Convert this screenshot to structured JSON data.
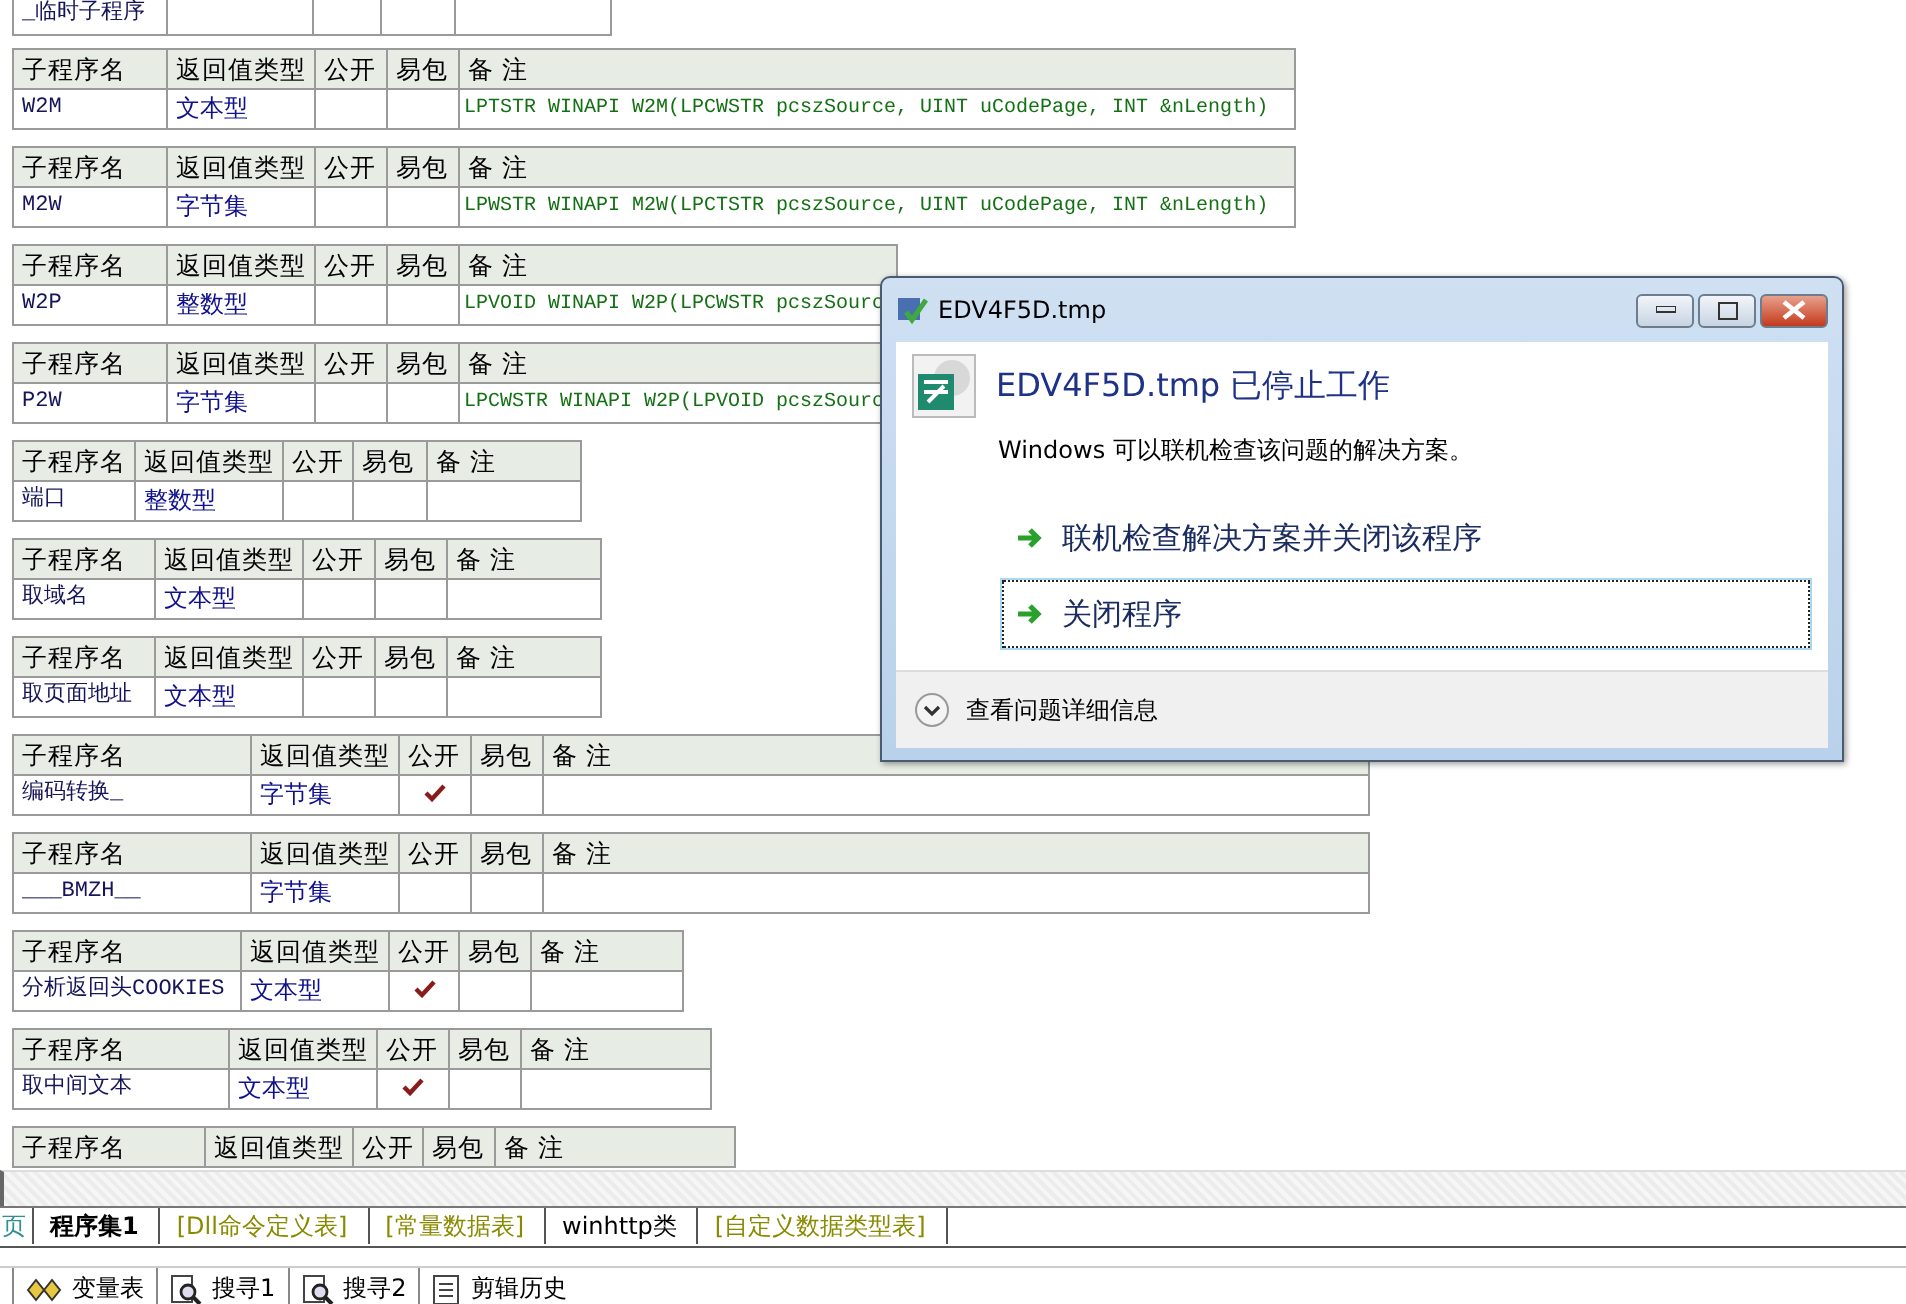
{
  "procedures": [
    {
      "name": "_临时子程序",
      "public": false
    },
    {
      "headers": [
        "子程序名",
        "返回值类型",
        "公开",
        "易包",
        "备 注"
      ],
      "name": "W2M",
      "return_type": "文本型",
      "public": false,
      "remark": "LPTSTR WINAPI W2M(LPCWSTR pcszSource, UINT uCodePage, INT &nLength)"
    },
    {
      "headers": [
        "子程序名",
        "返回值类型",
        "公开",
        "易包",
        "备 注"
      ],
      "name": "M2W",
      "return_type": "字节集",
      "public": false,
      "remark": "LPWSTR WINAPI M2W(LPCTSTR pcszSource, UINT uCodePage, INT &nLength)"
    },
    {
      "headers": [
        "子程序名",
        "返回值类型",
        "公开",
        "易包",
        "备 注"
      ],
      "name": "W2P",
      "return_type": "整数型",
      "public": false,
      "remark": "LPVOID WINAPI W2P(LPCWSTR pcszSourc"
    },
    {
      "headers": [
        "子程序名",
        "返回值类型",
        "公开",
        "易包",
        "备 注"
      ],
      "name": "P2W",
      "return_type": "字节集",
      "public": false,
      "remark": "LPCWSTR WINAPI W2P(LPVOID pcszSourc"
    },
    {
      "headers": [
        "子程序名",
        "返回值类型",
        "公开",
        "易包",
        "备 注"
      ],
      "name": "端口",
      "return_type": "整数型",
      "public": false
    },
    {
      "headers": [
        "子程序名",
        "返回值类型",
        "公开",
        "易包",
        "备 注"
      ],
      "name": "取域名",
      "return_type": "文本型",
      "public": false
    },
    {
      "headers": [
        "子程序名",
        "返回值类型",
        "公开",
        "易包",
        "备 注"
      ],
      "name": "取页面地址",
      "return_type": "文本型",
      "public": false
    },
    {
      "headers": [
        "子程序名",
        "返回值类型",
        "公开",
        "易包",
        "备 注"
      ],
      "name": "编码转换_",
      "return_type": "字节集",
      "public": true
    },
    {
      "headers": [
        "子程序名",
        "返回值类型",
        "公开",
        "易包",
        "备 注"
      ],
      "name": "___BMZH__",
      "return_type": "字节集",
      "public": false
    },
    {
      "headers": [
        "子程序名",
        "返回值类型",
        "公开",
        "易包",
        "备 注"
      ],
      "name": "分析返回头COOKIES",
      "return_type": "文本型",
      "public": true
    },
    {
      "headers": [
        "子程序名",
        "返回值类型",
        "公开",
        "易包",
        "备 注"
      ],
      "name": "取中间文本",
      "return_type": "文本型",
      "public": true
    },
    {
      "headers": [
        "子程序名",
        "返回值类型",
        "公开",
        "易包",
        "备 注"
      ]
    }
  ],
  "tabs": [
    {
      "label": "页",
      "kind": "page",
      "selected": false
    },
    {
      "label": "程序集1",
      "kind": "code",
      "selected": true
    },
    {
      "label": "[Dll命令定义表]",
      "kind": "table",
      "selected": false
    },
    {
      "label": "[常量数据表]",
      "kind": "table",
      "selected": false
    },
    {
      "label": "winhttp类",
      "kind": "code",
      "selected": false
    },
    {
      "label": "[自定义数据类型表]",
      "kind": "table",
      "selected": false
    }
  ],
  "toolbar": [
    {
      "label": "变量表",
      "kind": "variables"
    },
    {
      "label": "搜寻1",
      "kind": "search"
    },
    {
      "label": "搜寻2",
      "kind": "search"
    },
    {
      "label": "剪辑历史",
      "kind": "clipboard"
    }
  ],
  "dialog": {
    "title": "EDV4F5D.tmp",
    "heading": "EDV4F5D.tmp 已停止工作",
    "message": "Windows 可以联机检查该问题的解决方案。",
    "options": [
      {
        "label": "联机检查解决方案并关闭该程序",
        "selected": false
      },
      {
        "label": "关闭程序",
        "selected": true
      }
    ],
    "details": "查看问题详细信息"
  }
}
